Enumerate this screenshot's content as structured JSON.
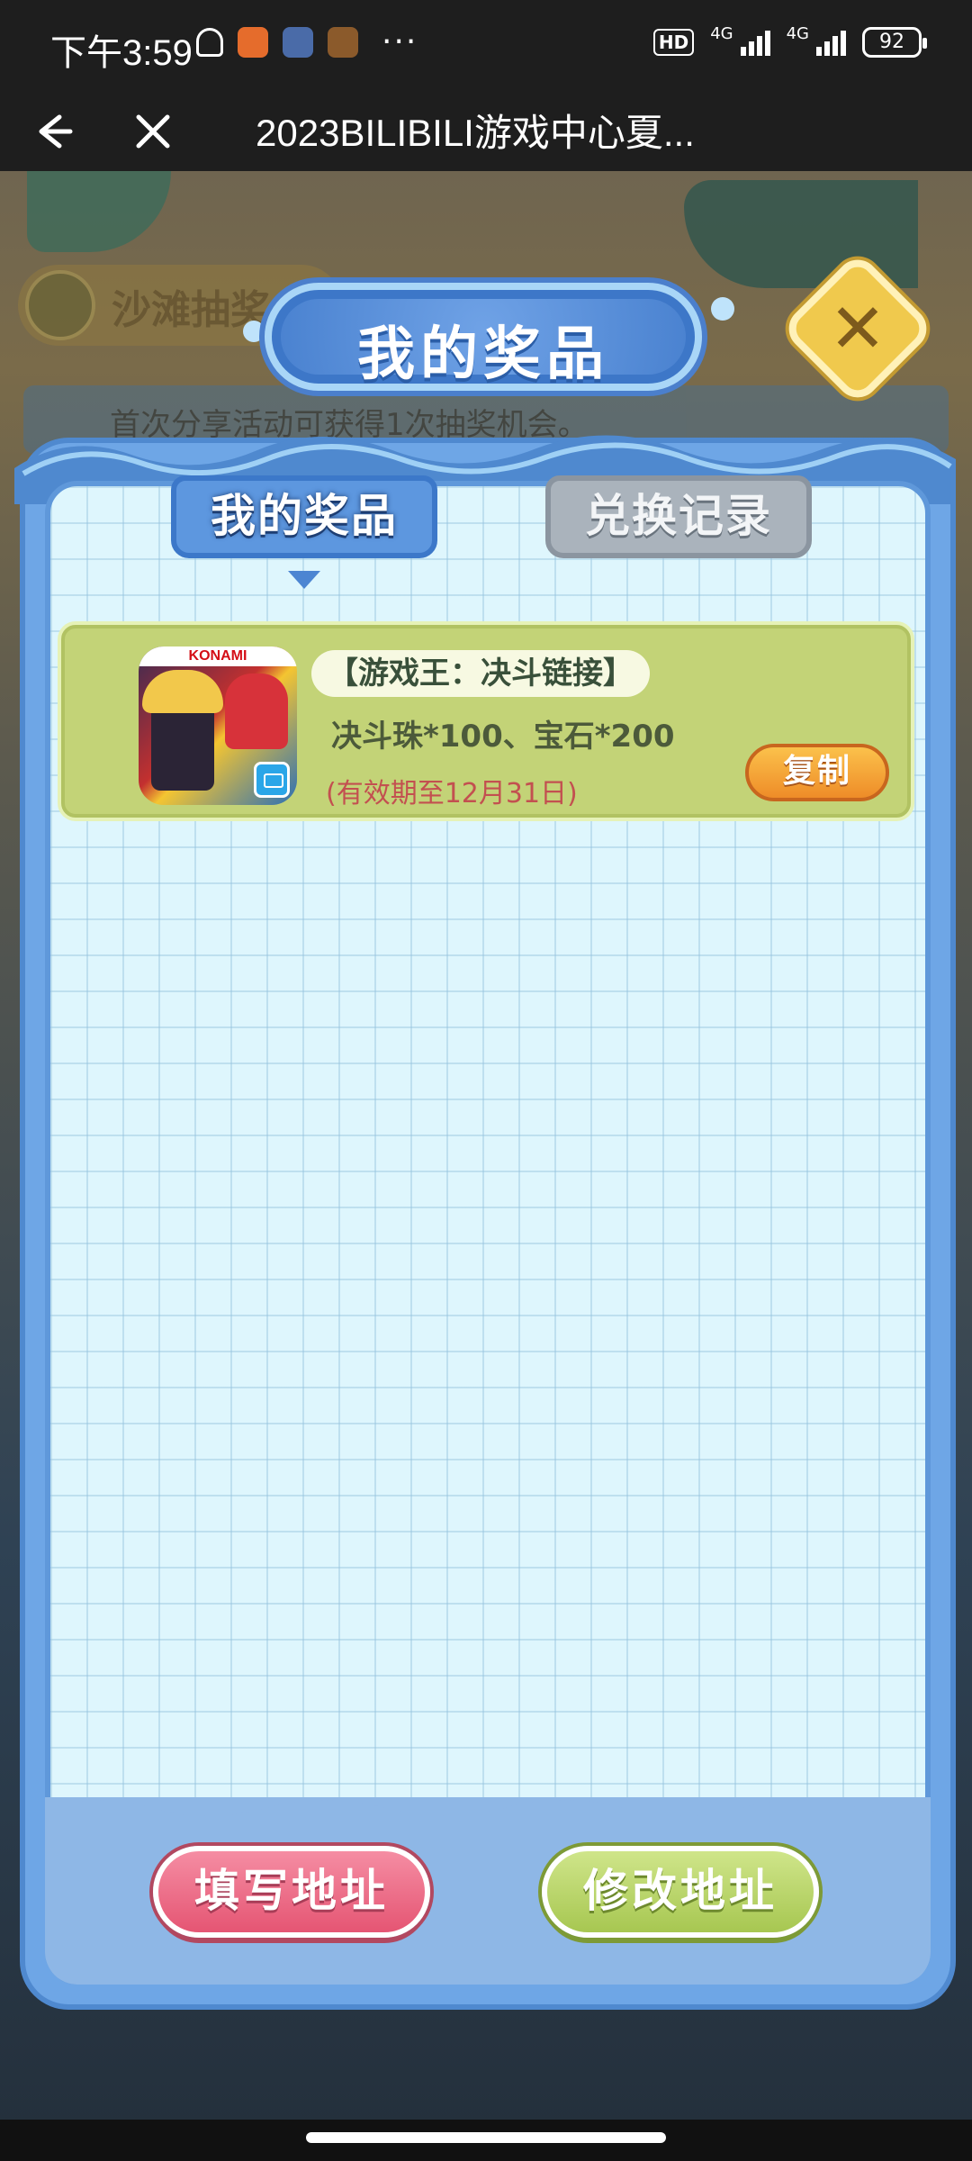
{
  "status_bar": {
    "time": "下午3:59",
    "hd": "HD",
    "net1": "4G",
    "net2": "4G",
    "battery": "92",
    "icons": [
      "bell-off-icon",
      "app-icon",
      "app-icon",
      "app-icon"
    ],
    "more": "···"
  },
  "browser": {
    "title": "2023BILIBILI游戏中心夏..."
  },
  "background": {
    "chip_label": "沙滩抽奖",
    "notice": "首次分享活动可获得1次抽奖机会。"
  },
  "modal": {
    "title": "我的奖品",
    "tabs": [
      {
        "label": "我的奖品",
        "active": true
      },
      {
        "label": "兑换记录",
        "active": false
      }
    ],
    "prizes": [
      {
        "game_brand": "KONAMI",
        "name": "【游戏王：决斗链接】",
        "description": "决斗珠*100、宝石*200",
        "validity": "(有效期至12月31日)",
        "copy_label": "复制"
      }
    ],
    "fill_address_label": "填写地址",
    "edit_address_label": "修改地址"
  },
  "colors": {
    "panel_blue": "#6ea6e6",
    "card_green": "#c3d377",
    "copy_orange": "#ee8c28",
    "fill_pink": "#e55573",
    "edit_green": "#a7c751",
    "close_yellow": "#f0c94d"
  }
}
